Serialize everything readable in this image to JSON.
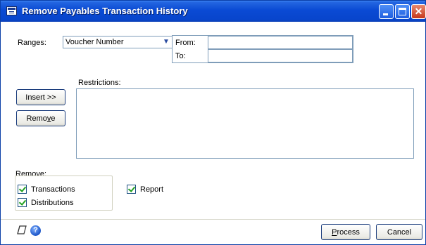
{
  "window": {
    "title": "Remove Payables Transaction History"
  },
  "ranges": {
    "label": "Ranges:",
    "selected": "Voucher Number",
    "from_label": "From:",
    "from_value": "",
    "to_label": "To:",
    "to_value": ""
  },
  "restrictions": {
    "label": "Restrictions:"
  },
  "buttons": {
    "insert": "Insert >>",
    "remove_pre": "Remo",
    "remove_ul": "v",
    "remove_post": "e",
    "process_pre": "",
    "process_ul": "P",
    "process_post": "rocess",
    "cancel": "Cancel"
  },
  "remove_group": {
    "label": "Remove:",
    "transactions": "Transactions",
    "distributions": "Distributions",
    "transactions_checked": true,
    "distributions_checked": true
  },
  "report": {
    "label": "Report",
    "checked": true
  },
  "footer": {
    "help_glyph": "?"
  }
}
